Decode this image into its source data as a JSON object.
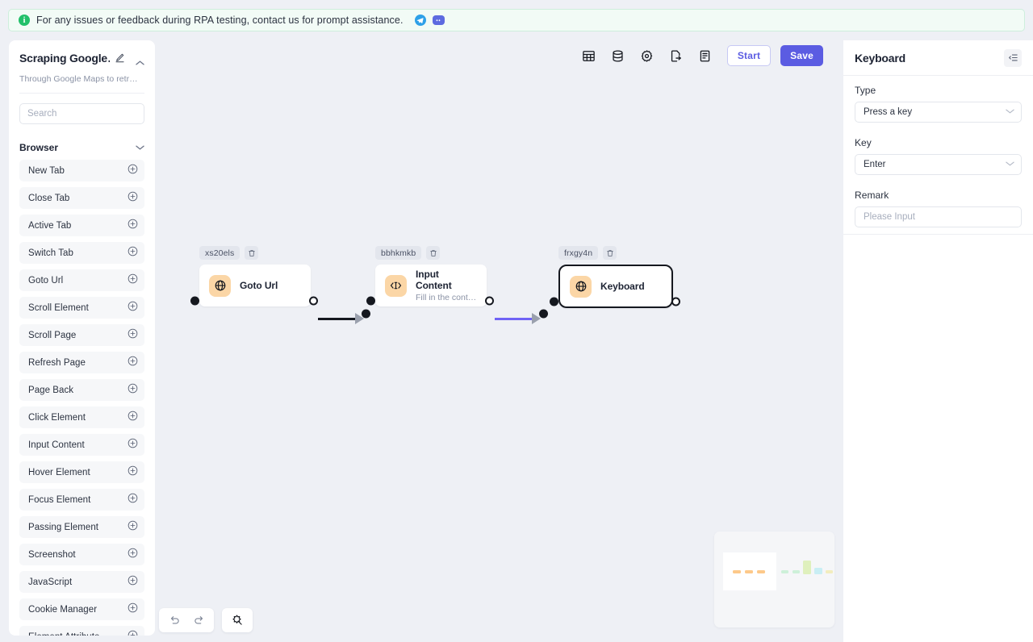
{
  "banner": {
    "icon": "info-circle-icon",
    "text": "For any issues or feedback during RPA testing, contact us for prompt assistance.",
    "telegram_icon": "telegram-icon",
    "discord_icon": "discord-icon"
  },
  "sidebar": {
    "title": "Scraping Google…",
    "subtitle": "Through Google Maps to retr…",
    "edit_icon": "pencil-icon",
    "collapse_icon": "chevron-up-icon",
    "search": {
      "value": "",
      "placeholder": "Search"
    },
    "group": {
      "label": "Browser",
      "chevron": "chevron-down-icon"
    },
    "items": [
      {
        "label": "New Tab",
        "add_icon": "plus-circle-icon"
      },
      {
        "label": "Close Tab",
        "add_icon": "plus-circle-icon"
      },
      {
        "label": "Active Tab",
        "add_icon": "plus-circle-icon"
      },
      {
        "label": "Switch Tab",
        "add_icon": "plus-circle-icon"
      },
      {
        "label": "Goto Url",
        "add_icon": "plus-circle-icon"
      },
      {
        "label": "Scroll Element",
        "add_icon": "plus-circle-icon"
      },
      {
        "label": "Scroll Page",
        "add_icon": "plus-circle-icon"
      },
      {
        "label": "Refresh Page",
        "add_icon": "plus-circle-icon"
      },
      {
        "label": "Page Back",
        "add_icon": "plus-circle-icon"
      },
      {
        "label": "Click Element",
        "add_icon": "plus-circle-icon"
      },
      {
        "label": "Input Content",
        "add_icon": "plus-circle-icon"
      },
      {
        "label": "Hover Element",
        "add_icon": "plus-circle-icon"
      },
      {
        "label": "Focus Element",
        "add_icon": "plus-circle-icon"
      },
      {
        "label": "Passing Element",
        "add_icon": "plus-circle-icon"
      },
      {
        "label": "Screenshot",
        "add_icon": "plus-circle-icon"
      },
      {
        "label": "JavaScript",
        "add_icon": "plus-circle-icon"
      },
      {
        "label": "Cookie Manager",
        "add_icon": "plus-circle-icon"
      },
      {
        "label": "Element Attribute",
        "add_icon": "plus-circle-icon"
      }
    ]
  },
  "toolbar": {
    "icons": [
      {
        "name": "table-icon"
      },
      {
        "name": "database-icon"
      },
      {
        "name": "gear-icon"
      },
      {
        "name": "export-file-icon"
      },
      {
        "name": "log-document-icon"
      }
    ],
    "start_label": "Start",
    "save_label": "Save",
    "accent_color": "#5b5ce2"
  },
  "canvas": {
    "nodes": [
      {
        "id": "xs20els",
        "title": "Goto Url",
        "subtitle": "",
        "icon": "globe-icon",
        "icon_bg": "#fbd6a6",
        "selected": false,
        "delete_icon": "trash-icon"
      },
      {
        "id": "bbhkmkb",
        "title": "Input Content",
        "subtitle": "Fill in the cont…",
        "icon": "input-brackets-icon",
        "icon_bg": "#fbd6a6",
        "selected": false,
        "delete_icon": "trash-icon"
      },
      {
        "id": "frxgy4n",
        "title": "Keyboard",
        "subtitle": "",
        "icon": "globe-icon",
        "icon_bg": "#fbd6a6",
        "selected": true,
        "delete_icon": "trash-icon"
      }
    ],
    "edges": [
      {
        "from": "xs20els",
        "to": "bbhkmkb",
        "color": "#15181f"
      },
      {
        "from": "bbhkmkb",
        "to": "frxgy4n",
        "color": "#6f63f5"
      }
    ],
    "controls": {
      "undo_icon": "undo-icon",
      "redo_icon": "redo-icon",
      "autolayout_icon": "magic-wand-icon"
    },
    "minimap": {
      "nodes": [
        {
          "color": "#fdc98a"
        },
        {
          "color": "#fdc98a"
        },
        {
          "color": "#fdc98a"
        },
        {
          "color": "#cdf0d9"
        },
        {
          "color": "#cdf0d9"
        },
        {
          "color": "#dff0bd"
        },
        {
          "color": "#c9eef4"
        },
        {
          "color": "#f2edbe"
        }
      ]
    }
  },
  "rightpanel": {
    "title": "Keyboard",
    "toggle_icon": "panel-collapse-icon",
    "fields": [
      {
        "label": "Type",
        "value": "Press a key",
        "control": "select",
        "chevron": "chevron-down-icon"
      },
      {
        "label": "Key",
        "value": "Enter",
        "control": "select",
        "chevron": "chevron-down-icon"
      },
      {
        "label": "Remark",
        "value": "",
        "placeholder": "Please Input",
        "control": "input"
      }
    ]
  }
}
